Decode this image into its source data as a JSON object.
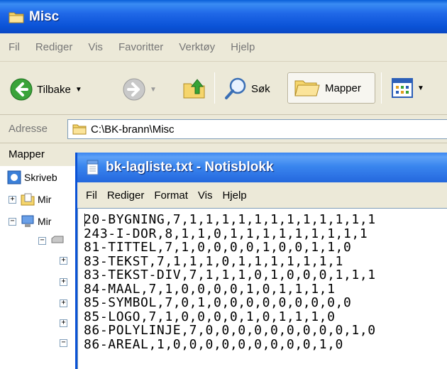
{
  "explorer": {
    "title": "Misc",
    "menu": [
      "Fil",
      "Rediger",
      "Vis",
      "Favoritter",
      "Verktøy",
      "Hjelp"
    ],
    "toolbar": {
      "back_label": "Tilbake",
      "search_label": "Søk",
      "folders_label": "Mapper"
    },
    "address": {
      "label": "Adresse",
      "value": "C:\\BK-brann\\Misc"
    },
    "folders_pane_title": "Mapper",
    "tree": [
      {
        "label": "Skriveb"
      },
      {
        "label": "Mir"
      },
      {
        "label": "Mir"
      }
    ]
  },
  "notepad": {
    "title": "bk-lagliste.txt - Notisblokk",
    "menu": [
      "Fil",
      "Rediger",
      "Format",
      "Vis",
      "Hjelp"
    ],
    "lines": [
      "20-BYGNING,7,1,1,1,1,1,1,1,1,1,1,1,1",
      "243-I-DOR,8,1,1,0,1,1,1,1,1,1,1,1,1",
      "81-TITTEL,7,1,0,0,0,0,1,0,0,1,1,0",
      "83-TEKST,7,1,1,1,0,1,1,1,1,1,1,1",
      "83-TEKST-DIV,7,1,1,1,0,1,0,0,0,1,1,1",
      "84-MAAL,7,1,0,0,0,0,1,0,1,1,1,1",
      "85-SYMBOL,7,0,1,0,0,0,0,0,0,0,0,0",
      "85-LOGO,7,1,0,0,0,0,1,0,1,1,1,0",
      "86-POLYLINJE,7,0,0,0,0,0,0,0,0,0,1,0",
      "86-AREAL,1,0,0,0,0,0,0,0,0,0,1,0"
    ]
  },
  "colors": {
    "titlebar_blue": "#0a52d6",
    "window_face": "#ece9d8"
  }
}
